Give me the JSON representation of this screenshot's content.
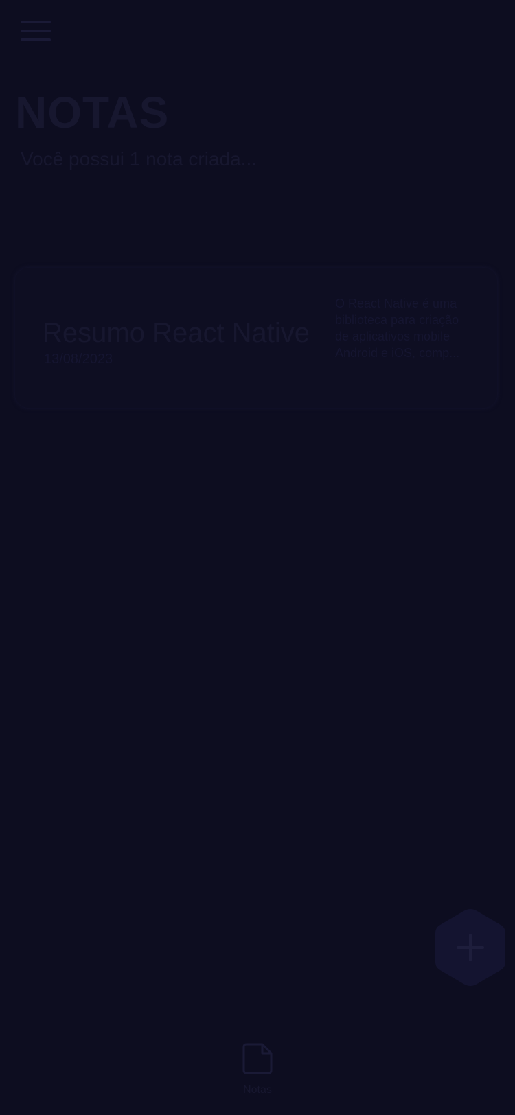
{
  "header": {
    "menu_icon": "hamburger-menu-icon",
    "title": "NOTAS",
    "subtitle": "Você possui 1 nota criada..."
  },
  "notes": [
    {
      "title": "Resumo React Native",
      "date": "13/08/2023",
      "preview": "O React Native é uma biblioteca para criação de aplicativos mobile Android e iOS, comp..."
    }
  ],
  "fab": {
    "icon": "plus-icon"
  },
  "tabbar": {
    "tabs": [
      {
        "label": "Notas",
        "icon": "note-icon"
      }
    ]
  },
  "colors": {
    "background": "#0d0d20",
    "dim_text": "#17172f",
    "card": "#0e0e22",
    "fab": "#141430"
  }
}
